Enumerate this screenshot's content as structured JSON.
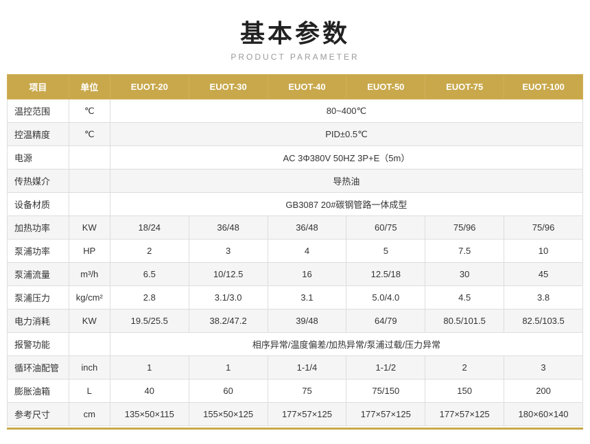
{
  "header": {
    "title": "基本参数",
    "subtitle": "PRODUCT PARAMETER"
  },
  "table": {
    "columns": [
      {
        "key": "item",
        "label": "项目"
      },
      {
        "key": "unit",
        "label": "单位"
      },
      {
        "key": "euot20",
        "label": "EUOT-20"
      },
      {
        "key": "euot30",
        "label": "EUOT-30"
      },
      {
        "key": "euot40",
        "label": "EUOT-40"
      },
      {
        "key": "euot50",
        "label": "EUOT-50"
      },
      {
        "key": "euot75",
        "label": "EUOT-75"
      },
      {
        "key": "euot100",
        "label": "EUOT-100"
      }
    ],
    "rows": [
      {
        "item": "温控范围",
        "unit": "℃",
        "span": true,
        "spanValue": "80~400℃"
      },
      {
        "item": "控温精度",
        "unit": "℃",
        "span": true,
        "spanValue": "PID±0.5℃"
      },
      {
        "item": "电源",
        "unit": "",
        "span": true,
        "spanValue": "AC 3Φ380V 50HZ 3P+E（5m）"
      },
      {
        "item": "传热媒介",
        "unit": "",
        "span": true,
        "spanValue": "导热油"
      },
      {
        "item": "设备材质",
        "unit": "",
        "span": true,
        "spanValue": "GB3087   20#碳钢管路一体成型"
      },
      {
        "item": "加热功率",
        "unit": "KW",
        "span": false,
        "values": [
          "18/24",
          "36/48",
          "36/48",
          "60/75",
          "75/96",
          "75/96"
        ]
      },
      {
        "item": "泵浦功率",
        "unit": "HP",
        "span": false,
        "values": [
          "2",
          "3",
          "4",
          "5",
          "7.5",
          "10"
        ]
      },
      {
        "item": "泵浦流量",
        "unit": "m³/h",
        "span": false,
        "values": [
          "6.5",
          "10/12.5",
          "16",
          "12.5/18",
          "30",
          "45"
        ]
      },
      {
        "item": "泵浦压力",
        "unit": "kg/cm²",
        "span": false,
        "values": [
          "2.8",
          "3.1/3.0",
          "3.1",
          "5.0/4.0",
          "4.5",
          "3.8"
        ]
      },
      {
        "item": "电力消耗",
        "unit": "KW",
        "span": false,
        "values": [
          "19.5/25.5",
          "38.2/47.2",
          "39/48",
          "64/79",
          "80.5/101.5",
          "82.5/103.5"
        ]
      },
      {
        "item": "报警功能",
        "unit": "",
        "span": true,
        "spanValue": "相序异常/温度偏差/加热异常/泵浦过载/压力异常"
      },
      {
        "item": "循环油配管",
        "unit": "inch",
        "span": false,
        "values": [
          "1",
          "1",
          "1-1/4",
          "1-1/2",
          "2",
          "3"
        ]
      },
      {
        "item": "膨胀油箱",
        "unit": "L",
        "span": false,
        "values": [
          "40",
          "60",
          "75",
          "75/150",
          "150",
          "200"
        ]
      },
      {
        "item": "参考尺寸",
        "unit": "cm",
        "span": false,
        "values": [
          "135×50×115",
          "155×50×125",
          "177×57×125",
          "177×57×125",
          "177×57×125",
          "180×60×140"
        ]
      }
    ]
  }
}
